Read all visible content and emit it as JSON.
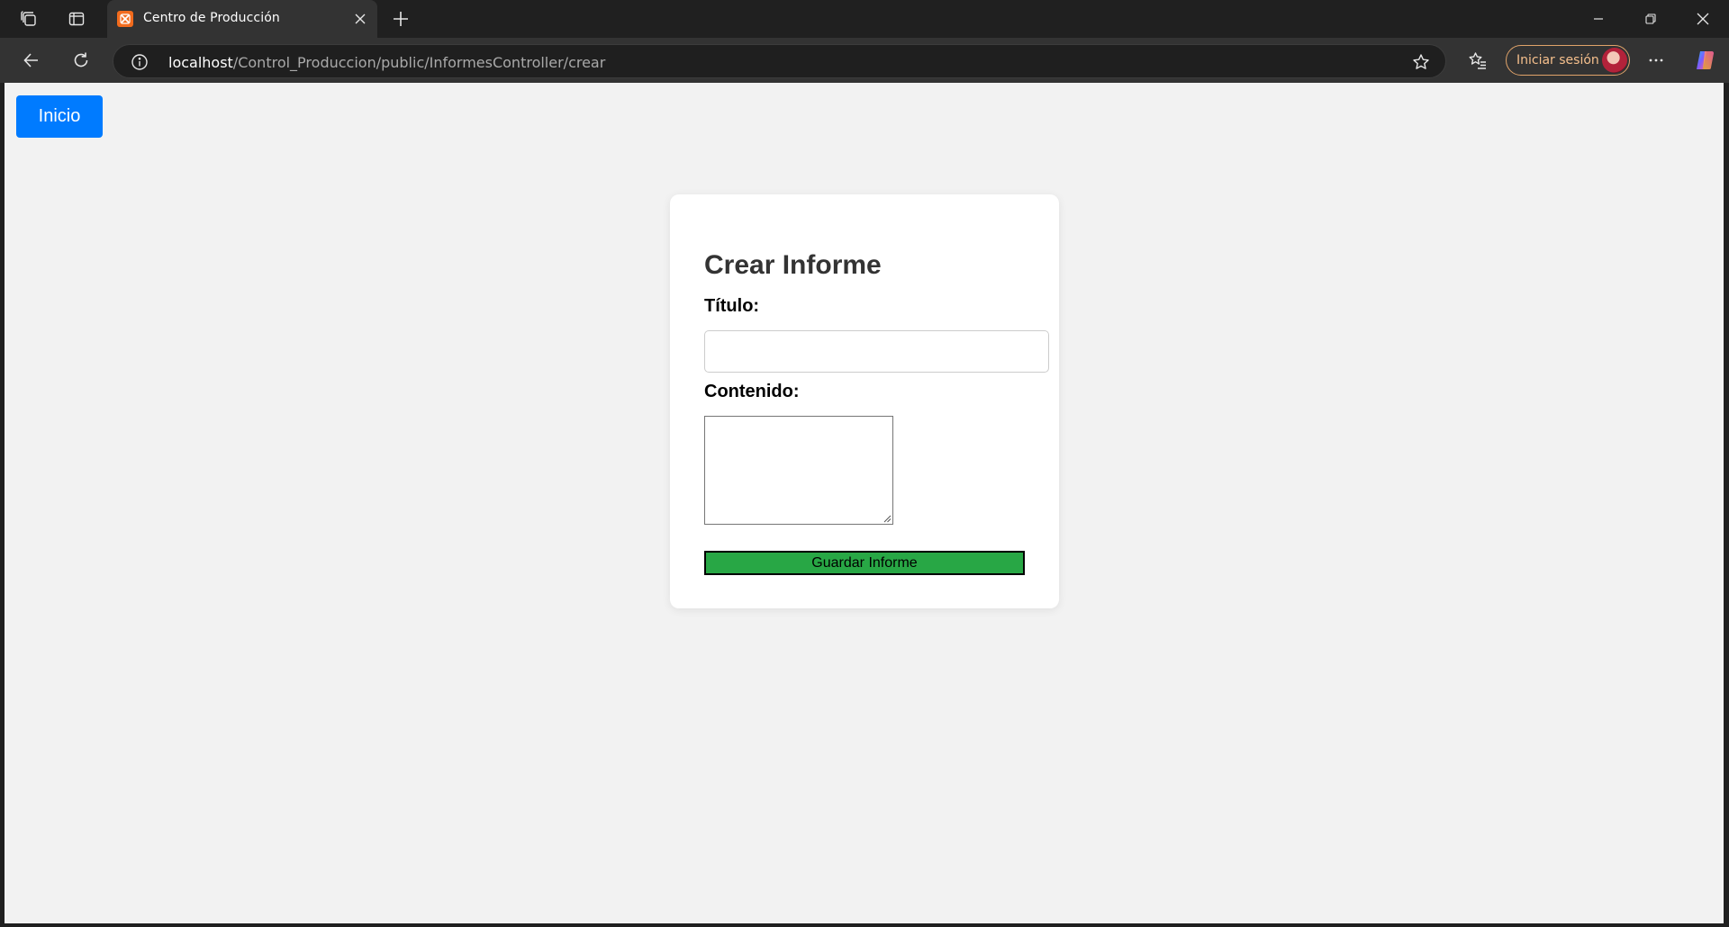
{
  "browser": {
    "tab": {
      "title": "Centro de Producción",
      "favicon": "xampp-icon"
    },
    "address_bar": {
      "host": "localhost",
      "path": "/Control_Produccion/public/InformesController/crear"
    },
    "signin_label": "Iniciar sesión",
    "icons": {
      "workspaces": "workspaces-icon",
      "tab_actions": "tab-actions-icon",
      "new_tab": "plus-icon",
      "back": "back-arrow-icon",
      "refresh": "refresh-icon",
      "site_info": "info-icon",
      "favorite": "star-icon",
      "favorites": "favorites-icon",
      "more": "more-icon",
      "copilot": "copilot-icon",
      "minimize": "minimize-icon",
      "restore": "restore-icon",
      "close": "close-icon"
    }
  },
  "page": {
    "home_button": "Inicio",
    "form": {
      "heading": "Crear Informe",
      "title_label": "Título:",
      "title_value": "",
      "content_label": "Contenido:",
      "content_value": "",
      "submit_label": "Guardar Informe"
    }
  },
  "colors": {
    "home_button": "#007bff",
    "submit_button": "#28a745",
    "page_background": "#f2f2f2",
    "card_background": "#ffffff"
  }
}
